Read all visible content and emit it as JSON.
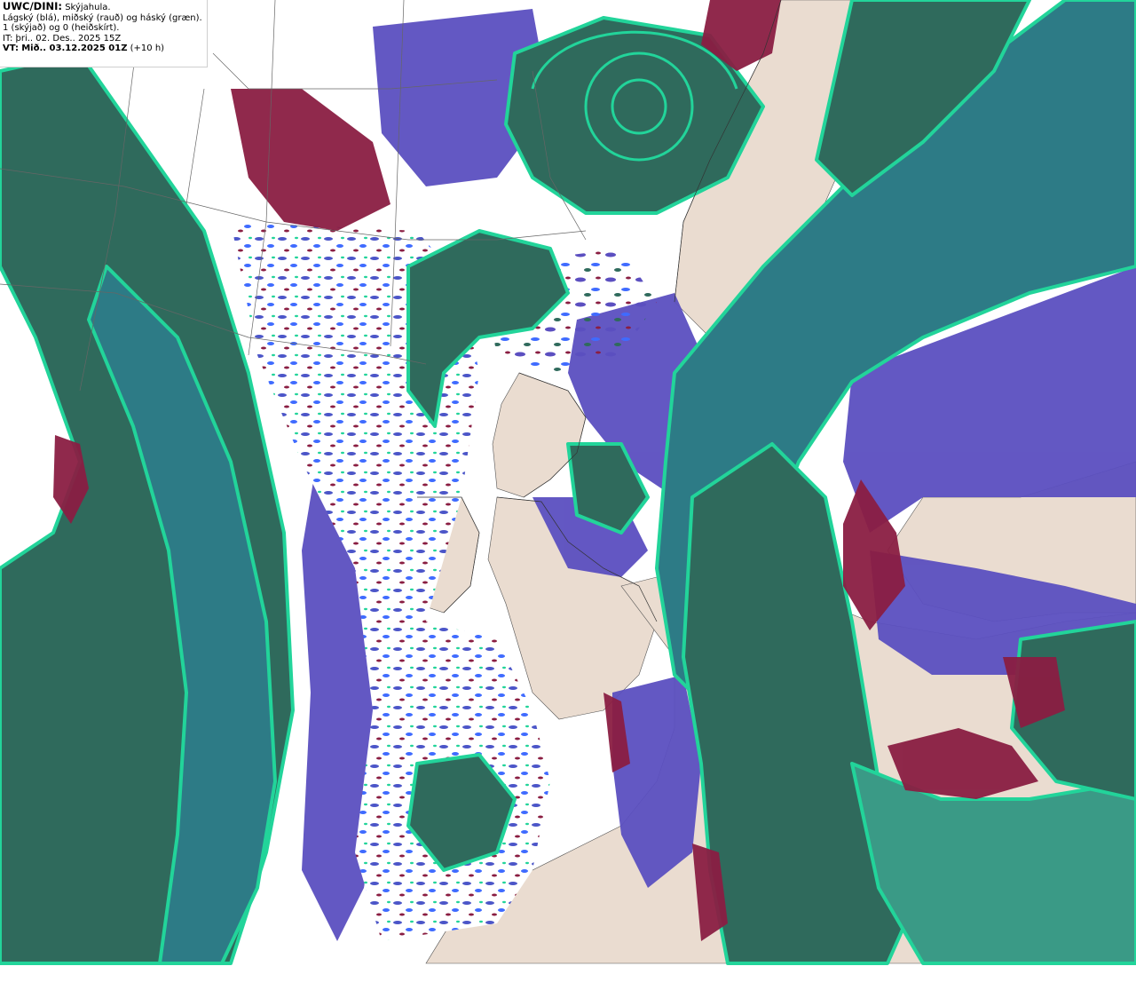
{
  "legend": {
    "model": "UWC/DINI:",
    "title": "Skýjahula.",
    "line2": "Lágský (blá), miðský (rauð) og háský (græn).",
    "line3": "1 (skýjað) og 0 (heiðskírt).",
    "initial_time": "IT: þri.. 02. Des.. 2025 15Z",
    "valid_label": "VT:",
    "valid_time": "Mið.. 03.12.2025 01Z",
    "lead_time": "(+10 h)"
  },
  "colors": {
    "background": "#ffffff",
    "land": "#eadcd0",
    "low_cloud": "#5b4fc0",
    "low_cloud_light": "#3f6bff",
    "mid_cloud": "#8a1e42",
    "mid_cloud_light": "#d65a50",
    "high_cloud": "#2f6a5c",
    "high_cloud_edge": "#22d49a",
    "mixed_cloud": "#2d7b86",
    "coastline": "#333333",
    "grid": "#666666"
  }
}
